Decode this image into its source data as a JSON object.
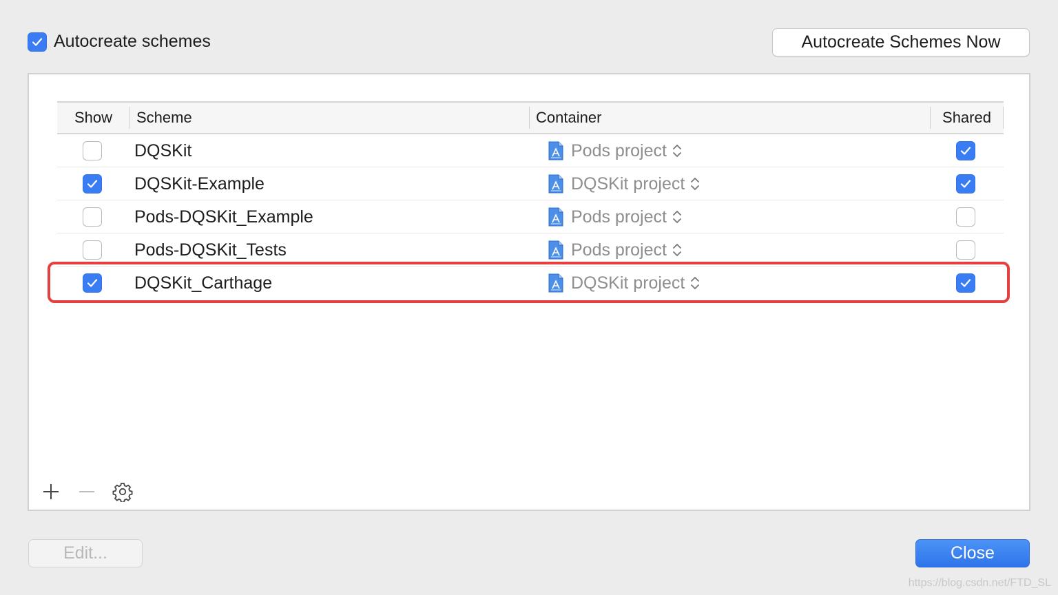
{
  "top": {
    "autocreate_checked": true,
    "autocreate_label": "Autocreate schemes",
    "autocreate_now_label": "Autocreate Schemes Now"
  },
  "table": {
    "headers": {
      "show": "Show",
      "scheme": "Scheme",
      "container": "Container",
      "shared": "Shared"
    },
    "rows": [
      {
        "show": false,
        "scheme": "DQSKit",
        "container": "Pods project",
        "shared": true
      },
      {
        "show": true,
        "scheme": "DQSKit-Example",
        "container": "DQSKit project",
        "shared": true
      },
      {
        "show": false,
        "scheme": "Pods-DQSKit_Example",
        "container": "Pods project",
        "shared": false
      },
      {
        "show": false,
        "scheme": "Pods-DQSKit_Tests",
        "container": "Pods project",
        "shared": false
      },
      {
        "show": true,
        "scheme": "DQSKit_Carthage",
        "container": "DQSKit project",
        "shared": true
      }
    ]
  },
  "toolbar": {
    "add_icon": "plus-icon",
    "remove_icon": "minus-icon",
    "settings_icon": "gear-icon"
  },
  "buttons": {
    "edit_label": "Edit...",
    "close_label": "Close"
  },
  "highlight_color": "#e5403f",
  "accent_color": "#3a7cf3",
  "watermark": "https://blog.csdn.net/FTD_SL"
}
